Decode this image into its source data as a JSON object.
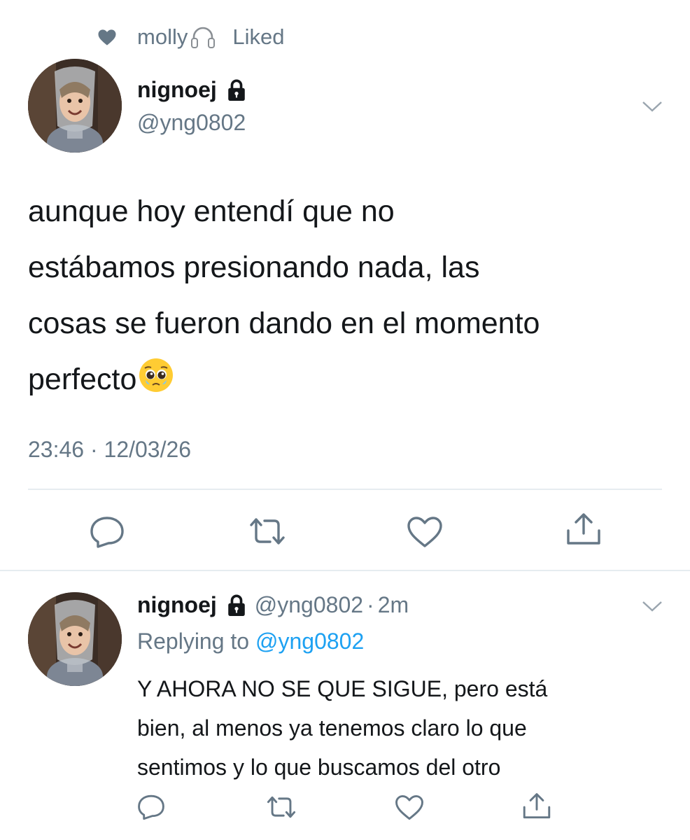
{
  "social_context": {
    "user": "molly",
    "action": "Liked"
  },
  "main_tweet": {
    "display_name": "nignoej",
    "handle": "@yng0802",
    "lines": [
      "aunque hoy entendí que no",
      "estábamos presionando nada, las",
      "cosas se fueron dando en el momento",
      "perfecto"
    ],
    "emoji": "pleading-face",
    "timestamp": "23:46 · 12/03/26"
  },
  "reply_tweet": {
    "display_name": "nignoej",
    "handle": "@yng0802",
    "separator": "·",
    "age": "2m",
    "replying_prefix": "Replying to ",
    "replying_handle": "@yng0802",
    "lines": [
      "Y AHORA NO SE QUE SIGUE, pero está",
      "bien, al menos ya tenemos claro lo que",
      "sentimos y lo que buscamos del otro"
    ]
  },
  "icons": {
    "reply": "reply-icon",
    "retweet": "retweet-icon",
    "like": "heart-icon",
    "share": "share-icon"
  },
  "colors": {
    "text": "#14171a",
    "secondary": "#657786",
    "icon": "#657786",
    "link": "#1da1f2",
    "divider": "#e6ecf0"
  }
}
